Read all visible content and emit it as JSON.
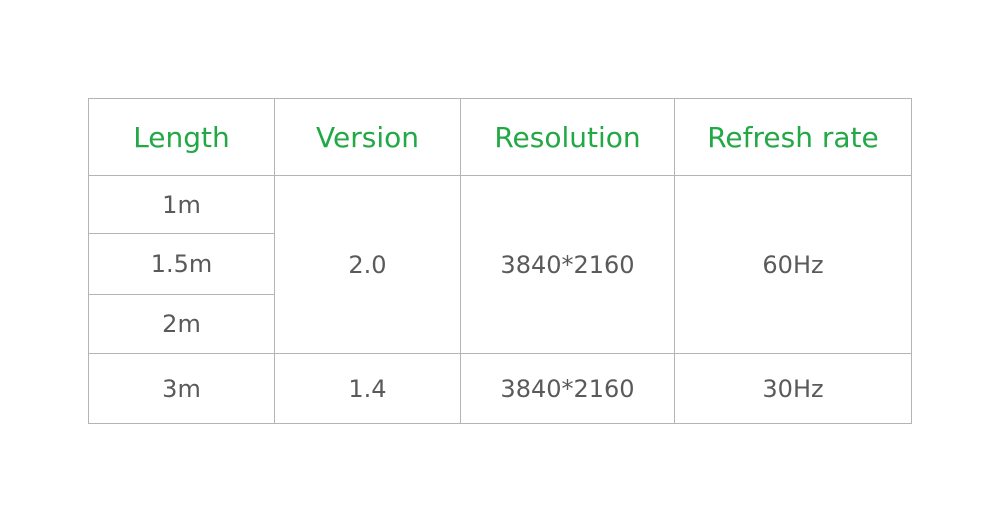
{
  "colors": {
    "header_text": "#22a845",
    "body_text": "#5a5a5a",
    "border": "#b4b4b4"
  },
  "table": {
    "headers": [
      "Length",
      "Version",
      "Resolution",
      "Refresh rate"
    ],
    "lengths": [
      "1m",
      "1.5m",
      "2m",
      "3m"
    ],
    "group_a": {
      "version": "2.0",
      "resolution": "3840*2160",
      "refresh": "60Hz"
    },
    "group_b": {
      "version": "1.4",
      "resolution": "3840*2160",
      "refresh": "30Hz"
    }
  }
}
